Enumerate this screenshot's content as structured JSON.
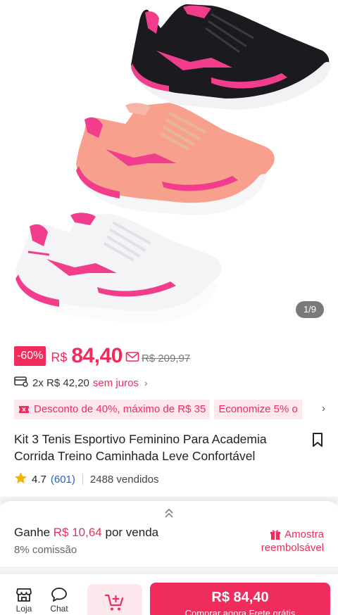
{
  "gallery": {
    "counter": "1/9"
  },
  "price": {
    "discount_badge": "-60%",
    "currency": "R$",
    "current": "84,40",
    "original": "R$ 209,97"
  },
  "installment": {
    "text": "2x R$ 42,20",
    "interest": "sem juros",
    "chevron": "›"
  },
  "promos": [
    {
      "label": "Desconto de 40%, máximo de R$ 35"
    },
    {
      "label": "Economize 5% o"
    }
  ],
  "promo_chevron": "›",
  "product": {
    "title": "Kit 3 Tenis Esportivo Feminino Para Academia Corrida Treino Caminhada Leve Confortável",
    "rating": "4.7",
    "rating_count": "(601)",
    "sold": "2488 vendidos"
  },
  "commission": {
    "earn_prefix": "Ganhe ",
    "earn_amount": "R$ 10,64",
    "earn_suffix": " por venda",
    "rate": "8% comissão",
    "sample_line1": "Amostra",
    "sample_line2": "reembolsável"
  },
  "bottom_bar": {
    "store_label": "Loja",
    "chat_label": "Chat",
    "buy_price": "R$ 84,40",
    "buy_sub": "Comprar agora  Frete grátis"
  },
  "colors": {
    "accent": "#ee2d5c",
    "accent_light": "#fde8ee",
    "shoe_black": "#1b1b1f",
    "shoe_peach": "#f7a08e",
    "shoe_white": "#f4f4f6",
    "shoe_pink": "#f23d8d"
  },
  "icons": {
    "star": "star-icon",
    "bookmark": "bookmark-icon",
    "store": "store-icon",
    "chat": "chat-bubble-icon",
    "cart": "add-to-cart-icon",
    "sample": "gift-icon",
    "mail": "coupon-mail-icon",
    "installment": "card-icon",
    "promo": "ticket-icon",
    "expand": "double-chevron-up-icon"
  }
}
